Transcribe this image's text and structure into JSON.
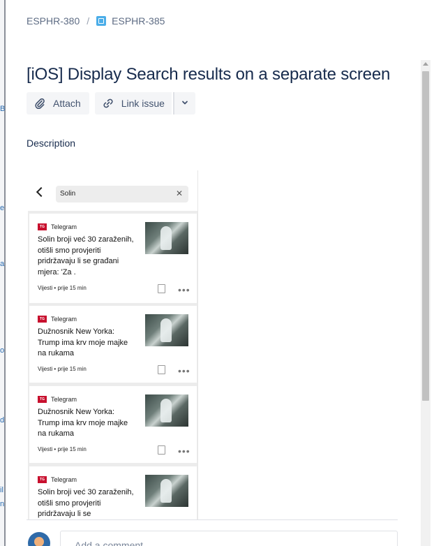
{
  "backdrop": {
    "fragments": [
      "B",
      "e",
      "a",
      "o",
      "d",
      "il",
      "n"
    ]
  },
  "breadcrumb": {
    "parent": "ESPHR-380",
    "separator": "/",
    "current": "ESPHR-385"
  },
  "issue": {
    "title": "[iOS] Display Search results on a separate screen"
  },
  "toolbar": {
    "attach_label": "Attach",
    "link_issue_label": "Link issue"
  },
  "description": {
    "label": "Description",
    "screenshot": {
      "search_value": "Solin",
      "cards": [
        {
          "source": "Telegram",
          "badge": "TG",
          "headline": "Solin broji već 30 zaraženih, otišli smo provjeriti pridržavaju li se građani mjera: 'Za .",
          "meta": "Vijesti • prije 15 min"
        },
        {
          "source": "Telegram",
          "badge": "TG",
          "headline": "Dužnosnik New Yorka: Trump ima krv moje majke na rukama",
          "meta": "Vijesti • prije 15 min"
        },
        {
          "source": "Telegram",
          "badge": "TG",
          "headline": "Dužnosnik New Yorka: Trump ima krv moje majke na rukama",
          "meta": "Vijesti • prije 15 min"
        },
        {
          "source": "Telegram",
          "badge": "TG",
          "headline": "Solin broji već 30 zaraženih, otišli smo provjeriti pridržavaju li se",
          "meta": ""
        }
      ]
    }
  },
  "comment": {
    "placeholder": "Add a comment..."
  },
  "colors": {
    "issue_type": "#4bade8",
    "brand_badge": "#c8102e",
    "text_primary": "#172b4d",
    "text_secondary": "#5e6c84"
  }
}
